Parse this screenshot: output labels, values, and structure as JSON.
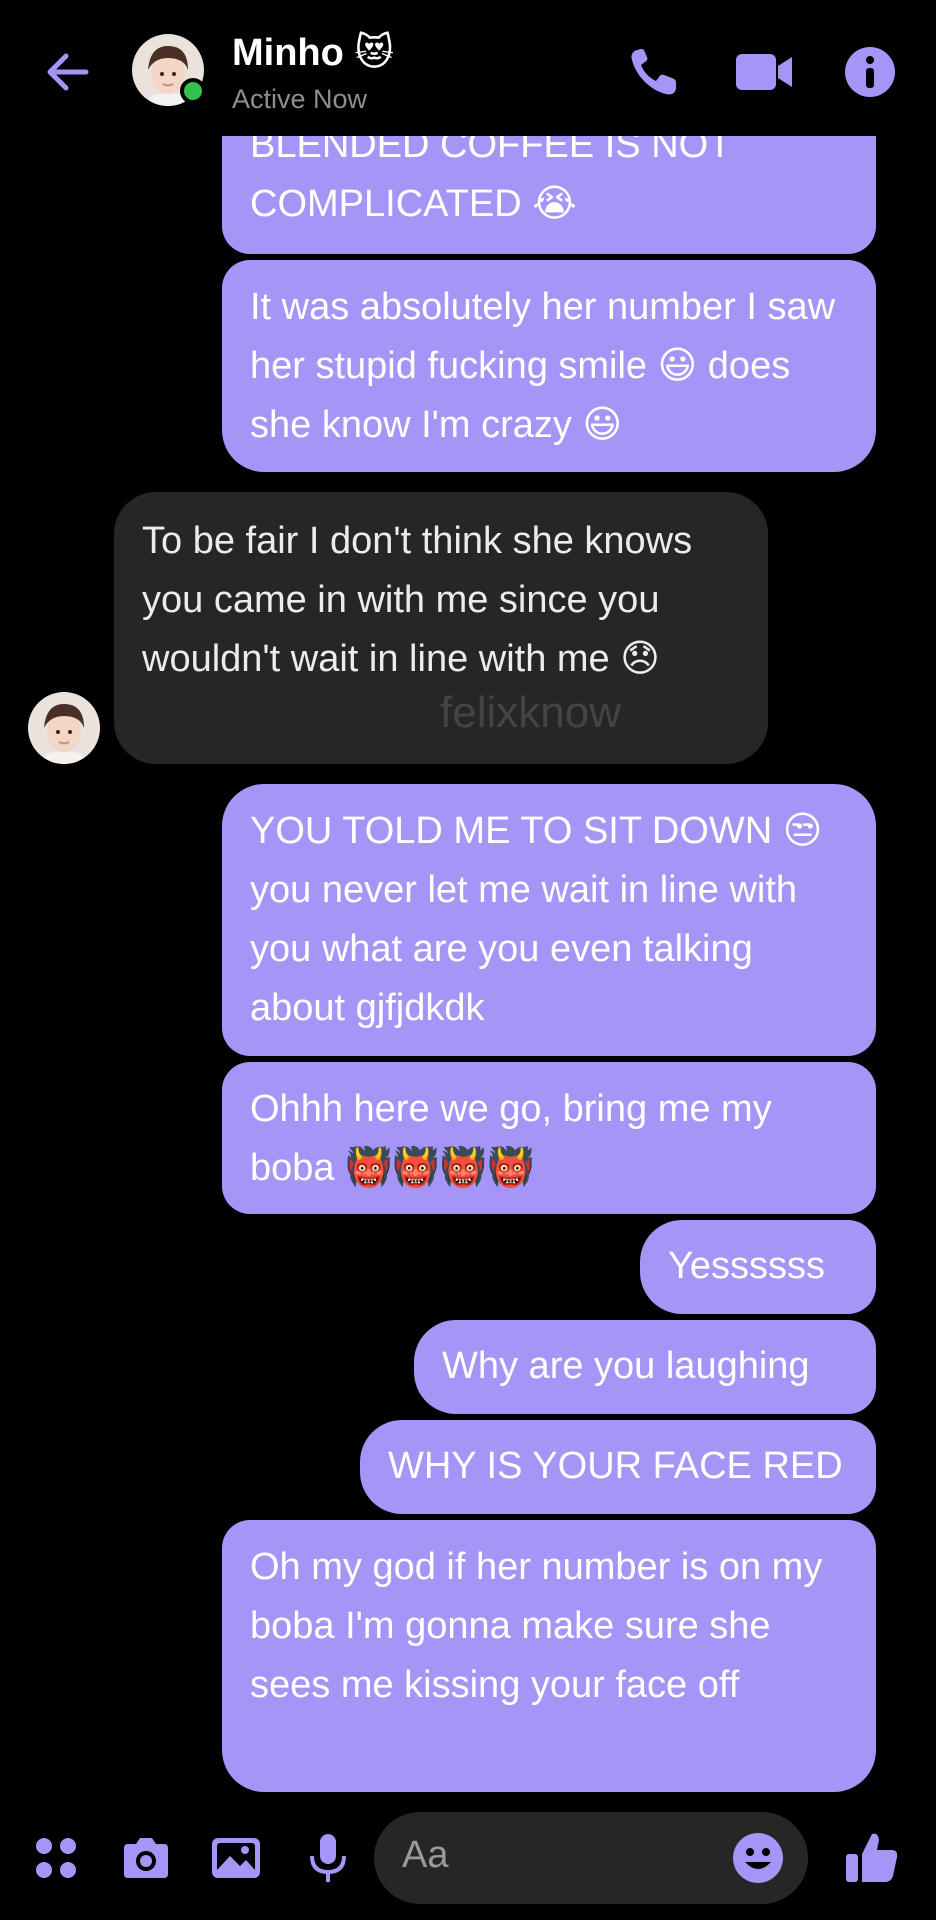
{
  "header": {
    "contact_name": "Minho 😻",
    "status": "Active Now"
  },
  "colors": {
    "accent": "#a595f7",
    "incoming_bubble": "#262626",
    "online": "#31c24d"
  },
  "icons": {
    "back": "arrow-left-icon",
    "phone": "phone-icon",
    "video": "video-camera-icon",
    "info": "info-icon",
    "apps": "four-dots-icon",
    "camera": "camera-icon",
    "gallery": "image-icon",
    "mic": "microphone-icon",
    "emoji": "smiley-icon",
    "like": "thumbs-up-icon"
  },
  "messages": [
    {
      "dir": "out",
      "text": "BLENDED COFFEE IS NOT COMPLICATED 😭"
    },
    {
      "dir": "out",
      "text": "It was absolutely her number I saw her stupid fucking smile 😃 does she know I'm crazy 😃"
    },
    {
      "dir": "in",
      "text": "To be fair I don't think she knows you came in with me since you wouldn't wait in line with me 😞"
    },
    {
      "dir": "out",
      "text": "YOU TOLD ME TO SIT DOWN 😒 you never let me wait in line with you what are you even talking about gjfjdkdk"
    },
    {
      "dir": "out",
      "text": "Ohhh here we go, bring me my boba 👹👹👹👹"
    },
    {
      "dir": "out",
      "text": "Yessssss"
    },
    {
      "dir": "out",
      "text": "Why are you laughing"
    },
    {
      "dir": "out",
      "text": "WHY IS YOUR FACE RED"
    },
    {
      "dir": "out",
      "text": "Oh my god if her number is on my boba I'm gonna make sure she sees me kissing your face off"
    }
  ],
  "watermark": "felixknow",
  "composer": {
    "placeholder": "Aa"
  }
}
